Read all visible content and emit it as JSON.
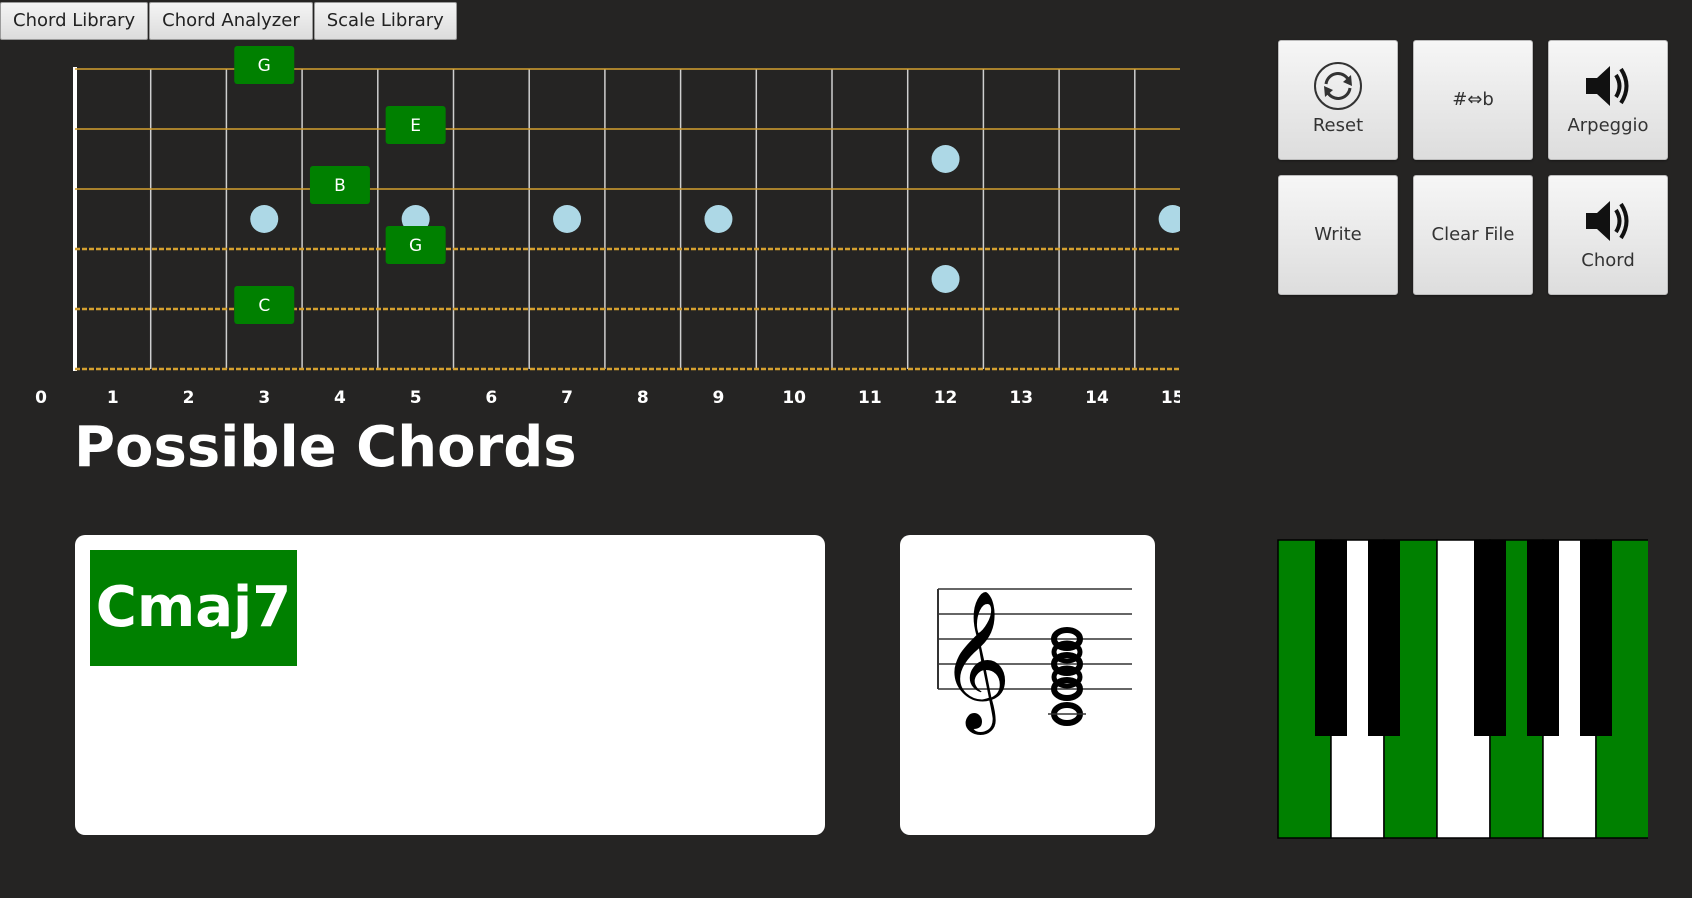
{
  "tabs": [
    "Chord Library",
    "Chord Analyzer",
    "Scale Library"
  ],
  "fretboard": {
    "string_count": 6,
    "fret_count": 15,
    "fret_numbers": [
      "0",
      "1",
      "2",
      "3",
      "4",
      "5",
      "6",
      "7",
      "8",
      "9",
      "10",
      "11",
      "12",
      "13",
      "14",
      "15"
    ],
    "inlay_markers": [
      {
        "fret": 3,
        "string": 4
      },
      {
        "fret": 5,
        "string": 4
      },
      {
        "fret": 7,
        "string": 4
      },
      {
        "fret": 9,
        "string": 4
      },
      {
        "fret": 12,
        "string": 3
      },
      {
        "fret": 12,
        "string": 5
      },
      {
        "fret": 15,
        "string": 4
      }
    ],
    "notes": [
      {
        "label": "G",
        "string": 1,
        "fret": 3
      },
      {
        "label": "E",
        "string": 2,
        "fret": 5
      },
      {
        "label": "B",
        "string": 3,
        "fret": 4
      },
      {
        "label": "G",
        "string": 4,
        "fret": 5
      },
      {
        "label": "C",
        "string": 5,
        "fret": 3
      }
    ],
    "colors": {
      "string": "#d4a030",
      "fret": "#cfcfcf",
      "nut": "#ffffff",
      "inlay": "#add8e6",
      "note": "#008000"
    }
  },
  "toolbar": {
    "reset": "Reset",
    "enharmonic": "#⇔b",
    "arpeggio": "Arpeggio",
    "write": "Write",
    "clear_file": "Clear File",
    "chord": "Chord"
  },
  "section": {
    "heading": "Possible Chords"
  },
  "possible_chords": [
    {
      "name": "Cmaj7"
    }
  ],
  "staff": {
    "clef": "treble-clef",
    "notes": [
      "C4",
      "E4",
      "G4",
      "B4"
    ]
  },
  "piano": {
    "white_keys": [
      "C",
      "D",
      "E",
      "F",
      "G",
      "A",
      "B"
    ],
    "highlighted_white": [
      "C",
      "E",
      "G",
      "B"
    ],
    "highlight_color": "#008000"
  }
}
